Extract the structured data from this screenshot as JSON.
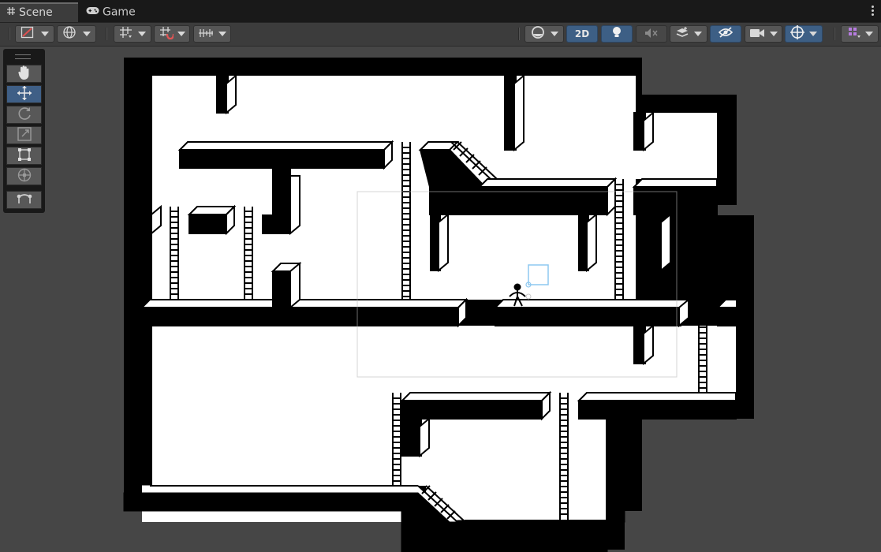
{
  "tabs": [
    {
      "label": "Scene",
      "icon": "grid-icon",
      "active": true
    },
    {
      "label": "Game",
      "icon": "gamepad-icon",
      "active": false
    }
  ],
  "toolbar": {
    "mode_2d_label": "2D",
    "accent_color": "#3d5f85",
    "left_buttons": [
      "draw-mode-icon",
      "global-pivot-icon",
      "grid-snap-icon",
      "increment-snap-icon",
      "ruler-icon"
    ],
    "right_buttons": [
      "shading-icon",
      "2d-toggle",
      "lighting-icon",
      "audio-mute-icon",
      "effects-icon",
      "hidden-objects-icon",
      "camera-icon",
      "gizmos-icon",
      "layers-icon"
    ]
  },
  "tools": [
    {
      "name": "hand-tool",
      "icon": "hand-icon",
      "active": false
    },
    {
      "name": "move-tool",
      "icon": "move-arrows-icon",
      "active": true
    },
    {
      "name": "rotate-tool",
      "icon": "rotate-icon",
      "active": false
    },
    {
      "name": "scale-tool",
      "icon": "scale-icon",
      "active": false
    },
    {
      "name": "rect-tool",
      "icon": "rect-transform-icon",
      "active": false
    },
    {
      "name": "transform-tool",
      "icon": "transform-icon",
      "active": false
    },
    {
      "name": "custom-tool",
      "icon": "custom-editor-tool-icon",
      "active": false
    }
  ],
  "scene": {
    "background_color": "#464646",
    "level_floor_color": "#ffffff",
    "level_wall_color": "#000000",
    "selection_color": "#8ec8f0"
  }
}
